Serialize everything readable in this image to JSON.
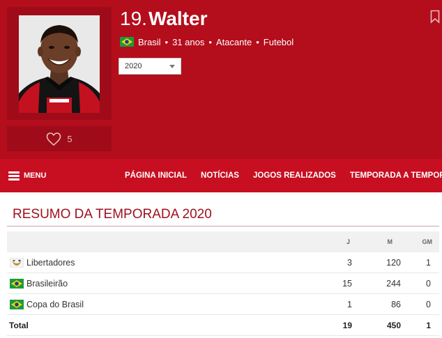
{
  "player": {
    "number": "19.",
    "surname": "Walter",
    "country": "Brasil",
    "age": "31 anos",
    "position": "Atacante",
    "sport": "Futebol",
    "likes": "5"
  },
  "season_select": {
    "selected": "2020"
  },
  "nav": {
    "menu_label": "MENU",
    "links": [
      "PÁGINA INICIAL",
      "NOTÍCIAS",
      "JOGOS REALIZADOS",
      "TEMPORADA A TEMPORADA"
    ]
  },
  "summary": {
    "title": "RESUMO DA TEMPORADA 2020",
    "columns": [
      "J",
      "M",
      "GM"
    ],
    "rows": [
      {
        "competition": "Libertadores",
        "icon": "libertadores-logo-icon",
        "j": "3",
        "m": "120",
        "gm": "1"
      },
      {
        "competition": "Brasileirão",
        "icon": "brazil-flag-icon",
        "j": "15",
        "m": "244",
        "gm": "0"
      },
      {
        "competition": "Copa do Brasil",
        "icon": "brazil-flag-icon",
        "j": "1",
        "m": "86",
        "gm": "0"
      }
    ],
    "total": {
      "label": "Total",
      "j": "19",
      "m": "450",
      "gm": "1"
    }
  },
  "colors": {
    "header_bg": "#b40d1c",
    "nav_bg": "#c70f21",
    "title_red": "#a01020",
    "brazil_green": "#1b9a3c",
    "brazil_yellow": "#f6d40c",
    "brazil_blue": "#1d3f8e"
  }
}
